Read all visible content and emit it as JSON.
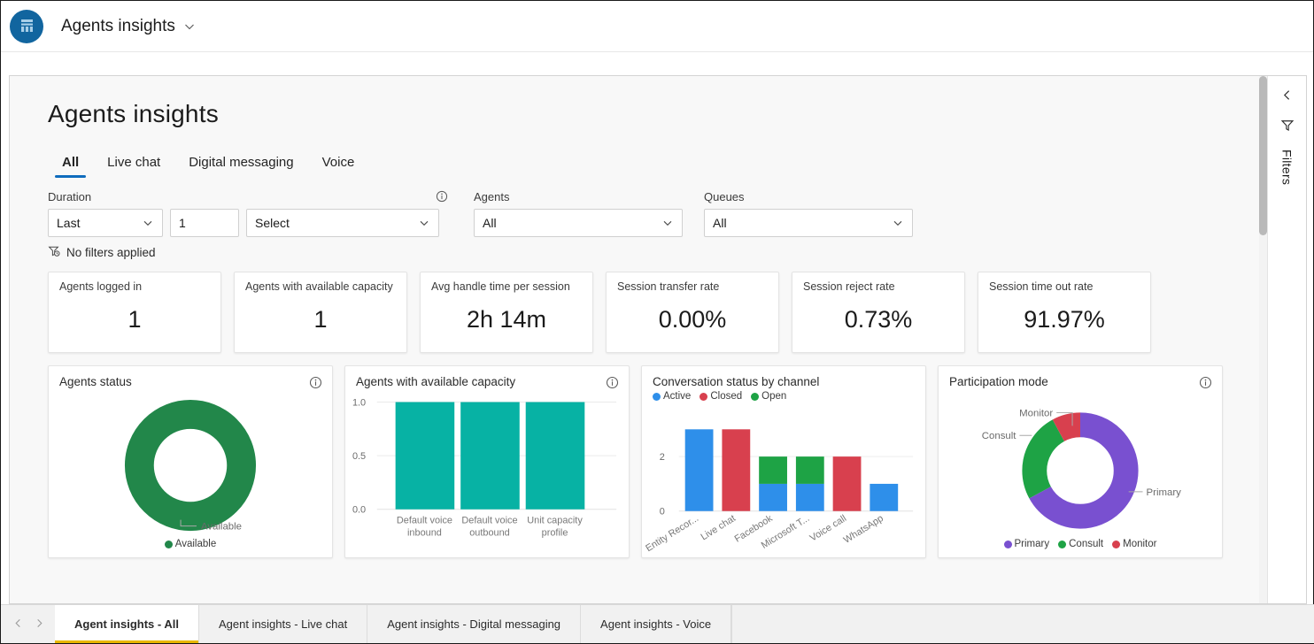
{
  "appbar": {
    "logo_icon": "dynamics-app-icon",
    "title": "Agents insights",
    "chevron_icon": "chevron-down-icon"
  },
  "page": {
    "title": "Agents insights"
  },
  "tabs": [
    {
      "label": "All",
      "active": true
    },
    {
      "label": "Live chat",
      "active": false
    },
    {
      "label": "Digital messaging",
      "active": false
    },
    {
      "label": "Voice",
      "active": false
    }
  ],
  "filters": {
    "duration": {
      "label": "Duration",
      "info_icon": "info-icon",
      "range_value": "Last",
      "range_chevron": "chevron-down-icon",
      "number_value": "1",
      "unit_value": "Select",
      "unit_chevron": "chevron-down-icon"
    },
    "agents": {
      "label": "Agents",
      "value": "All",
      "chevron": "chevron-down-icon"
    },
    "queues": {
      "label": "Queues",
      "value": "All",
      "chevron": "chevron-down-icon"
    },
    "status": {
      "icon": "filter-clock-icon",
      "text": "No filters applied"
    }
  },
  "kpis": [
    {
      "label": "Agents logged in",
      "value": "1"
    },
    {
      "label": "Agents with available capacity",
      "value": "1"
    },
    {
      "label": "Avg handle time per session",
      "value": "2h 14m"
    },
    {
      "label": "Session transfer rate",
      "value": "0.00%"
    },
    {
      "label": "Session reject rate",
      "value": "0.73%"
    },
    {
      "label": "Session time out rate",
      "value": "91.97%"
    }
  ],
  "cards": {
    "agents_status": {
      "title": "Agents status",
      "info_icon": "info-icon"
    },
    "available_cap": {
      "title": "Agents with available capacity",
      "info_icon": "info-icon"
    },
    "conversation": {
      "title": "Conversation status by channel",
      "info_icon": "none"
    },
    "participation": {
      "title": "Participation mode",
      "info_icon": "info-icon"
    }
  },
  "rail": {
    "collapse_icon": "chevron-left-icon",
    "funnel_icon": "funnel-icon",
    "label": "Filters"
  },
  "bottom_tabs": {
    "prev_icon": "chevron-left-icon",
    "next_icon": "chevron-right-icon",
    "items": [
      {
        "label": "Agent insights - All",
        "active": true
      },
      {
        "label": "Agent insights - Live chat",
        "active": false
      },
      {
        "label": "Agent insights - Digital messaging",
        "active": false
      },
      {
        "label": "Agent insights - Voice",
        "active": false
      }
    ]
  },
  "colors": {
    "accent_blue": "#0f6cbd",
    "logo_blue": "#11659f",
    "green": "#22874a",
    "teal": "#07b2a4",
    "bar_blue": "#2e8fea",
    "bar_red": "#d8404e",
    "bar_green": "#1ea345",
    "purple": "#7950d0",
    "active_tab_underline": "#e8b700"
  },
  "chart_data": [
    {
      "type": "pie",
      "title": "Agents status",
      "labels": [
        "Available"
      ],
      "values": [
        1
      ],
      "percentages": [
        100
      ],
      "colors": [
        "#22874a"
      ],
      "legend": [
        "Available"
      ],
      "legend_position": "bottom",
      "leader_labels": [
        "Available"
      ],
      "donut": true
    },
    {
      "type": "bar",
      "title": "Agents with available capacity",
      "categories": [
        "Default voice inbound",
        "Default voice outbound",
        "Unit capacity profile"
      ],
      "values": [
        1.0,
        1.0,
        1.0
      ],
      "ytick_labels": [
        "0.0",
        "0.5",
        "1.0"
      ],
      "ylim": [
        0,
        1.0
      ],
      "xlabel": "",
      "ylabel": "",
      "color": "#07b2a4",
      "grid": true,
      "legend_position": "none"
    },
    {
      "type": "bar",
      "stacked": true,
      "title": "Conversation status by channel",
      "categories": [
        "Entity Recor...",
        "Live chat",
        "Facebook",
        "Microsoft T...",
        "Voice call",
        "WhatsApp"
      ],
      "series": [
        {
          "name": "Active",
          "color": "#2e8fea",
          "values": [
            3,
            0,
            1,
            1,
            0,
            1
          ]
        },
        {
          "name": "Closed",
          "color": "#d8404e",
          "values": [
            0,
            3,
            0,
            0,
            2,
            0
          ]
        },
        {
          "name": "Open",
          "color": "#1ea345",
          "values": [
            0,
            0,
            1,
            1,
            0,
            0
          ]
        }
      ],
      "ytick_labels": [
        "0",
        "2"
      ],
      "ylim": [
        0,
        3.2
      ],
      "legend": [
        "Active",
        "Closed",
        "Open"
      ],
      "legend_position": "top-left",
      "grid": true
    },
    {
      "type": "pie",
      "title": "Participation mode",
      "labels": [
        "Primary",
        "Consult",
        "Monitor"
      ],
      "values": [
        67,
        25,
        8
      ],
      "percentages": [
        67,
        25,
        8
      ],
      "colors": [
        "#7950d0",
        "#1ea345",
        "#d8404e"
      ],
      "legend": [
        "Primary",
        "Consult",
        "Monitor"
      ],
      "legend_position": "bottom",
      "leader_labels": [
        "Primary",
        "Consult",
        "Monitor"
      ],
      "donut": true
    }
  ]
}
